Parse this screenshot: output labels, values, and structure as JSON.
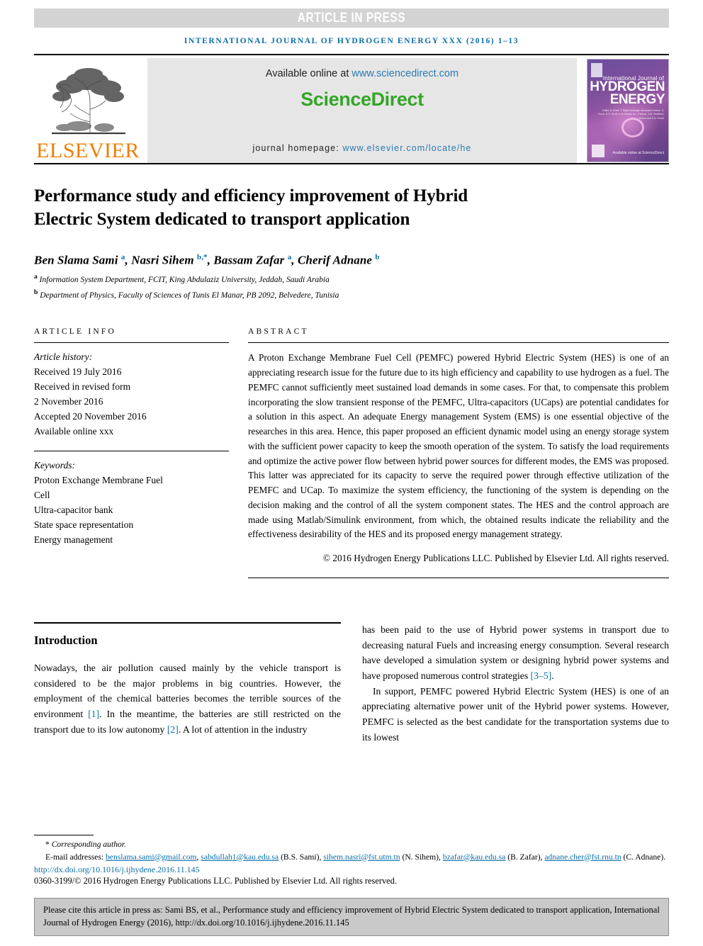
{
  "banner": {
    "text": "ARTICLE IN PRESS"
  },
  "running_head": "INTERNATIONAL JOURNAL OF HYDROGEN ENERGY XXX (2016) 1–13",
  "masthead": {
    "publisher_name": "ELSEVIER",
    "available_prefix": "Available online at ",
    "available_url": "www.sciencedirect.com",
    "sciencedirect_logo": "ScienceDirect",
    "homepage_prefix": "journal homepage: ",
    "homepage_url": "www.elsevier.com/locate/he",
    "cover": {
      "line_small": "International Journal of",
      "line1": "HYDROGEN",
      "line2": "ENERGY",
      "editors": "Editor-in-Chief: T. Nejat Veziroğlu  Associate Editors: S. Dunn, D.S. Scott, A. A-Garcia, A.L. Pivovar, J.W. Sheffield, I. Dincer and F.A. Ferioli",
      "science_direct": "Available online at ScienceDirect"
    }
  },
  "article": {
    "title": "Performance study and efficiency improvement of Hybrid Electric System dedicated to transport application",
    "authors_html": "Ben Slama Sami <sup>a</sup>, Nasri Sihem <sup>b,*</sup>, Bassam Zafar <sup>a</sup>, Cherif Adnane <sup>b</sup>",
    "affiliation_a": "Information System Department, FCIT, King Abdulaziz University, Jeddah, Saudi Arabia",
    "affiliation_b": "Department of Physics, Faculty of Sciences of Tunis El Manar, PB 2092, Belvedere, Tunisia"
  },
  "article_info": {
    "heading": "ARTICLE INFO",
    "history_label": "Article history:",
    "history": [
      "Received 19 July 2016",
      "Received in revised form",
      "2 November 2016",
      "Accepted 20 November 2016",
      "Available online xxx"
    ],
    "keywords_label": "Keywords:",
    "keywords": [
      "Proton Exchange Membrane Fuel",
      "Cell",
      "Ultra-capacitor bank",
      "State space representation",
      "Energy management"
    ]
  },
  "abstract": {
    "heading": "ABSTRACT",
    "body": "A Proton Exchange Membrane Fuel Cell (PEMFC) powered Hybrid Electric System (HES) is one of an appreciating research issue for the future due to its high efficiency and capability to use hydrogen as a fuel. The PEMFC cannot sufficiently meet sustained load demands in some cases. For that, to compensate this problem incorporating the slow transient response of the PEMFC, Ultra-capacitors (UCaps) are potential candidates for a solution in this aspect. An adequate Energy management System (EMS) is one essential objective of the researches in this area. Hence, this paper proposed an efficient dynamic model using an energy storage system with the sufficient power capacity to keep the smooth operation of the system. To satisfy the load requirements and optimize the active power flow between hybrid power sources for different modes, the EMS was proposed. This latter was appreciated for its capacity to serve the required power through effective utilization of the PEMFC and UCap. To maximize the system efficiency, the functioning of the system is depending on the decision making and the control of all the system component states. The HES and the control approach are made using Matlab/Simulink environment, from which, the obtained results indicate the reliability and the effectiveness desirability of the HES and its proposed energy management strategy.",
    "copyright": "© 2016 Hydrogen Energy Publications LLC. Published by Elsevier Ltd. All rights reserved."
  },
  "introduction": {
    "heading": "Introduction",
    "para1_a": "Nowadays, the air pollution caused mainly by the vehicle transport is considered to be the major problems in big countries. However, the employment of the chemical batteries becomes the terrible sources of the environment ",
    "ref1": "[1]",
    "para1_b": ". In the meantime, the batteries are still restricted on the transport due to its low autonomy ",
    "ref2": "[2]",
    "para1_c": ". A lot of attention in the industry has been paid to the use of Hybrid power systems in transport due to decreasing natural Fuels and increasing energy consumption. Several research have developed a simulation system or designing hybrid power systems and have proposed numerous control strategies ",
    "ref3": "[3–5]",
    "para1_d": ".",
    "para2": "In support, PEMFC powered Hybrid Electric System (HES) is one of an appreciating alternative power unit of the Hybrid power systems. However, PEMFC is selected as the best candidate for the transportation systems due to its lowest"
  },
  "footnote": {
    "corresponding": "Corresponding author.",
    "email_label": "E-mail addresses: ",
    "emails": [
      {
        "address": "benslama.sami@gmail.com",
        "owner": ""
      },
      {
        "address": "sabdullah1@kau.edu.sa",
        "owner": " (B.S. Sami), "
      },
      {
        "address": "sihem.nasri@fst.utm.tn",
        "owner": " (N. Sihem), "
      },
      {
        "address": "bzafar@kau.edu.sa",
        "owner": " (B. Zafar), "
      },
      {
        "address": "adnane.cher@fst.rnu.tn",
        "owner": " (C. Adnane)."
      }
    ],
    "doi": "http://dx.doi.org/10.1016/j.ijhydene.2016.11.145",
    "issn": "0360-3199/© 2016 Hydrogen Energy Publications LLC. Published by Elsevier Ltd. All rights reserved."
  },
  "cite_box": {
    "text": "Please cite this article in press as: Sami BS, et al., Performance study and efficiency improvement of Hybrid Electric System dedicated to transport application, International Journal of Hydrogen Energy (2016), http://dx.doi.org/10.1016/j.ijhydene.2016.11.145"
  },
  "colors": {
    "link_blue": "#0b6ea8",
    "sciencedirect_green": "#34a527",
    "elsevier_orange": "#f07d00",
    "banner_gray": "#d3d3d3",
    "cite_box_gray": "#c9c9c9"
  }
}
